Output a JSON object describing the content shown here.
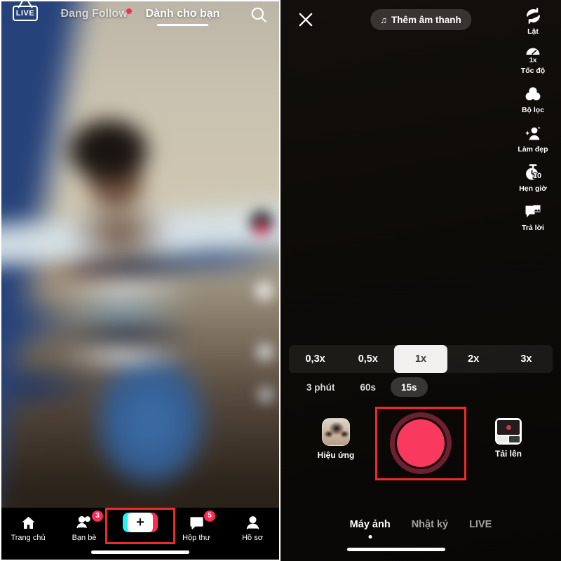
{
  "left_panel": {
    "live_badge": {
      "label": "LIVE",
      "icon": "live-tv-icon"
    },
    "tabs": [
      {
        "label": "Đang Follow",
        "active": false,
        "has_live_dot": true
      },
      {
        "label": "Dành cho bạn",
        "active": true,
        "has_live_dot": false
      }
    ],
    "search": {
      "icon": "search-icon"
    },
    "bottom_nav": [
      {
        "label": "Trang chủ",
        "icon": "home-icon",
        "badge": "",
        "active": true
      },
      {
        "label": "Bạn bè",
        "icon": "friends-icon",
        "badge": "3",
        "active": false
      },
      {
        "label": "",
        "icon": "create-plus-icon",
        "badge": "",
        "active": false,
        "highlighted": true,
        "plus": "+"
      },
      {
        "label": "Hộp thư",
        "icon": "inbox-icon",
        "badge": "5",
        "active": false
      },
      {
        "label": "Hồ sơ",
        "icon": "profile-icon",
        "badge": "",
        "active": false
      }
    ]
  },
  "right_panel": {
    "close": {
      "icon": "close-icon"
    },
    "add_sound": {
      "label": "Thêm âm thanh",
      "icon": "music-note-icon"
    },
    "tools": [
      {
        "label": "Lật",
        "icon": "flip-camera-icon"
      },
      {
        "label": "Tốc độ",
        "icon": "speed-gauge-icon",
        "value": "1x"
      },
      {
        "label": "Bộ lọc",
        "icon": "filters-icon"
      },
      {
        "label": "Làm đẹp",
        "icon": "beautify-icon"
      },
      {
        "label": "Hẹn giờ",
        "icon": "timer-icon",
        "value": "10"
      },
      {
        "label": "Trả lời",
        "icon": "reply-icon"
      }
    ],
    "speeds": [
      {
        "label": "0,3x",
        "active": false
      },
      {
        "label": "0,5x",
        "active": false
      },
      {
        "label": "1x",
        "active": true
      },
      {
        "label": "2x",
        "active": false
      },
      {
        "label": "3x",
        "active": false
      }
    ],
    "durations": [
      {
        "label": "3 phút",
        "active": false
      },
      {
        "label": "60s",
        "active": false
      },
      {
        "label": "15s",
        "active": true
      }
    ],
    "effects_button": {
      "label": "Hiệu ứng",
      "icon": "effects-thumbnail-icon"
    },
    "record_button": {
      "label": "",
      "icon": "record-button",
      "highlighted": true
    },
    "upload_button": {
      "label": "Tải lên",
      "icon": "upload-thumbnail-icon"
    },
    "modes": [
      {
        "label": "Máy ảnh",
        "active": true
      },
      {
        "label": "Nhật ký",
        "active": false
      },
      {
        "label": "LIVE",
        "active": false
      }
    ]
  },
  "colors": {
    "accent_pink": "#fe2c55",
    "accent_cyan": "#25f4ee",
    "highlight_red": "#ef2a2a",
    "record_fill": "#f93a5e",
    "record_ring": "#6d2030"
  }
}
